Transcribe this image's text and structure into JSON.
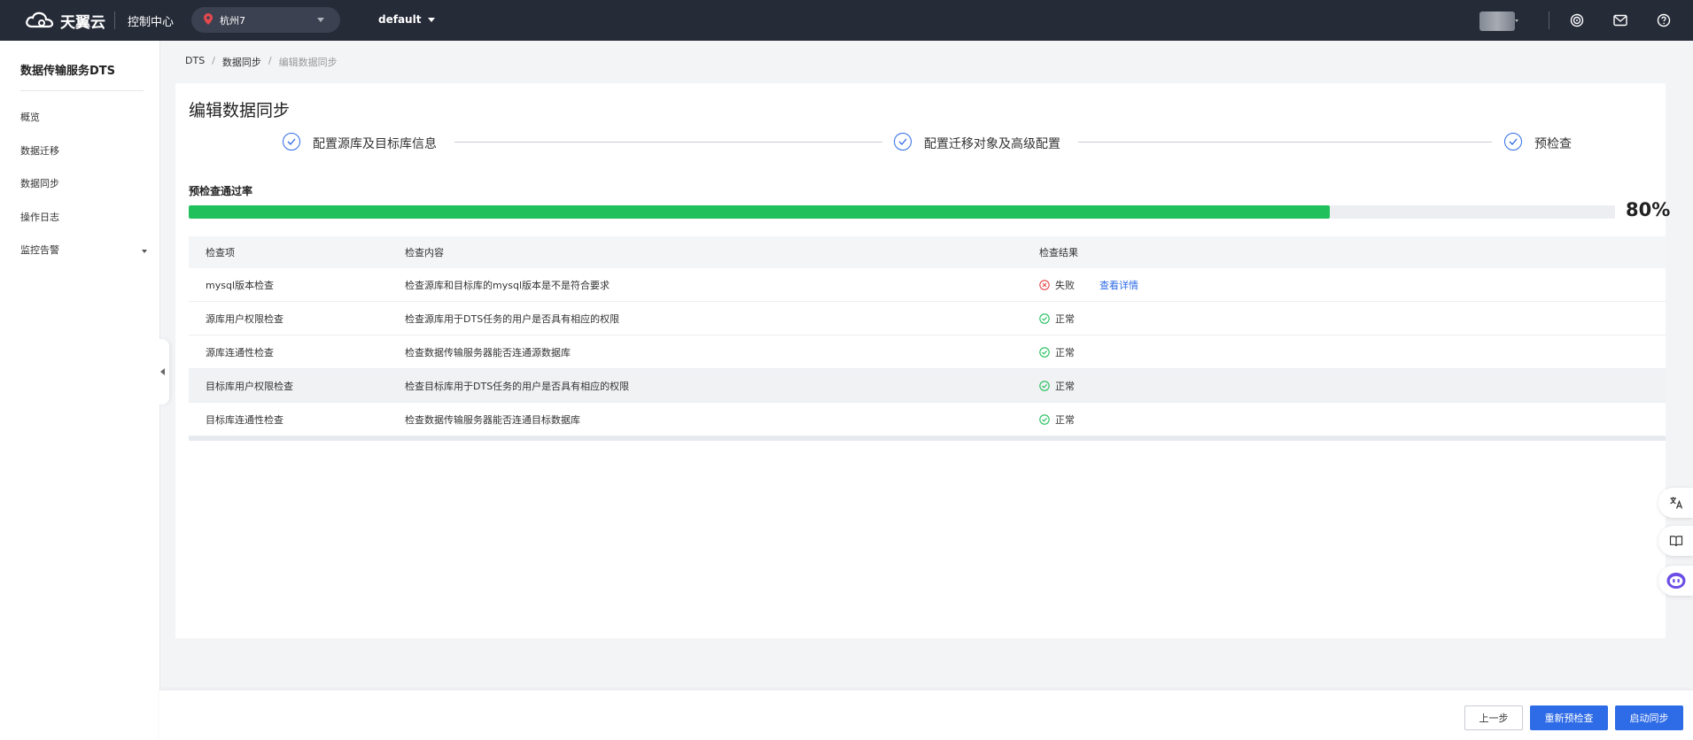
{
  "header": {
    "brand": "天翼云",
    "console": "控制中心",
    "region": "杭州7",
    "project": "default"
  },
  "sidebar": {
    "title": "数据传输服务DTS",
    "items": [
      "概览",
      "数据迁移",
      "数据同步",
      "操作日志",
      "监控告警"
    ]
  },
  "breadcrumb": [
    "DTS",
    "数据同步",
    "编辑数据同步"
  ],
  "page": {
    "title": "编辑数据同步",
    "steps": [
      "配置源库及目标库信息",
      "配置迁移对象及高级配置",
      "预检查"
    ],
    "pass_label": "预检查通过率",
    "pass_rate": 0.8,
    "pass_rate_text": "80%"
  },
  "table": {
    "headers": [
      "检查项",
      "检查内容",
      "检查结果"
    ],
    "rows": [
      {
        "item": "mysql版本检查",
        "content": "检查源库和目标库的mysql版本是不是符合要求",
        "result": "失败",
        "status": "fail",
        "link": "查看详情"
      },
      {
        "item": "源库用户权限检查",
        "content": "检查源库用于DTS任务的用户是否具有相应的权限",
        "result": "正常",
        "status": "ok"
      },
      {
        "item": "源库连通性检查",
        "content": "检查数据传输服务器能否连通源数据库",
        "result": "正常",
        "status": "ok"
      },
      {
        "item": "目标库用户权限检查",
        "content": "检查目标库用于DTS任务的用户是否具有相应的权限",
        "result": "正常",
        "status": "ok"
      },
      {
        "item": "目标库连通性检查",
        "content": "检查数据传输服务器能否连通目标数据库",
        "result": "正常",
        "status": "ok"
      }
    ]
  },
  "footer": {
    "prev": "上一步",
    "recheck": "重新预检查",
    "start": "启动同步"
  },
  "colors": {
    "accent": "#2e6be6",
    "success": "#20c05c",
    "fail": "#e5484d",
    "topbar": "#262b38"
  },
  "icons": [
    "cloud-logo-icon",
    "location-pin-icon",
    "target-icon",
    "mail-icon",
    "help-icon",
    "translate-icon",
    "book-icon",
    "robot-icon",
    "check-circle-icon",
    "close-circle-icon"
  ]
}
